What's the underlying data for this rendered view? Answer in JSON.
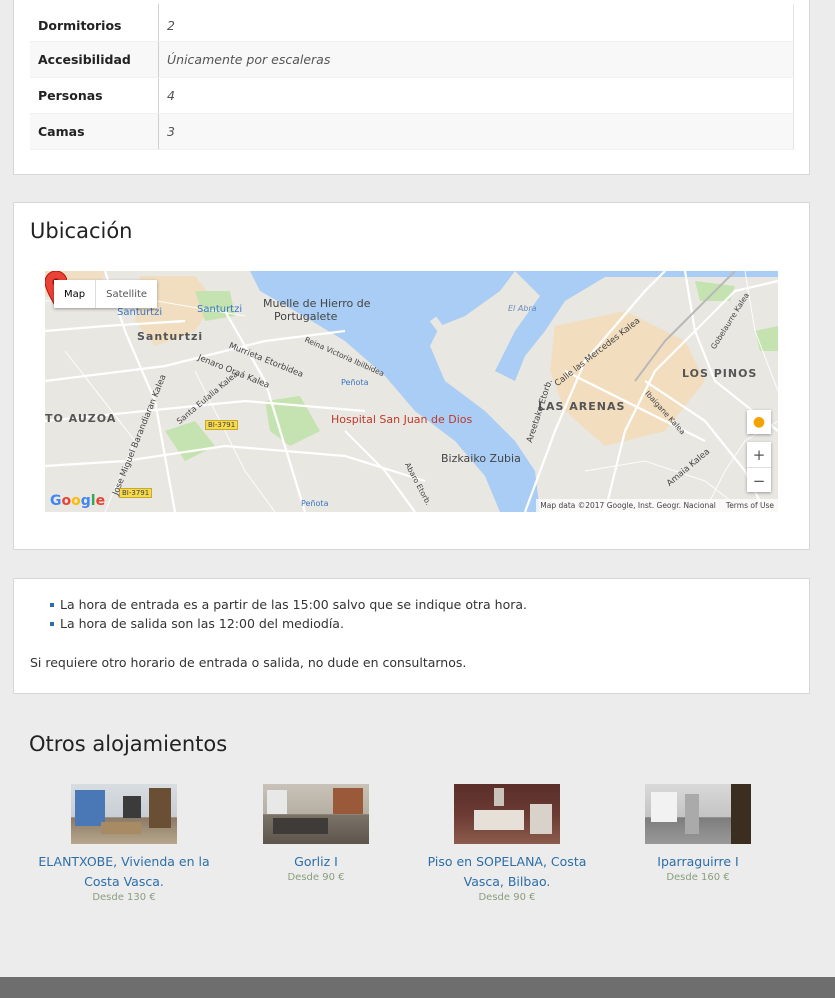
{
  "details": [
    {
      "label": "Dormitorios",
      "value": "2"
    },
    {
      "label": "Accesibilidad",
      "value": "Únicamente por escaleras"
    },
    {
      "label": "Personas",
      "value": "4"
    },
    {
      "label": "Camas",
      "value": "3"
    }
  ],
  "location": {
    "title": "Ubicación",
    "map_type_active": "Map",
    "map_type_inactive": "Satellite",
    "zoom_in": "+",
    "zoom_out": "−",
    "logo": "Google",
    "attribution": "Map data ©2017 Google, Inst. Geogr. Nacional",
    "terms": "Terms of Use",
    "labels": {
      "santurtzi_station": "Santurtzi",
      "santurtzi_station2": "Santurtzi",
      "santurtzi": "Santurtzi",
      "muelle1": "Muelle de Hierro de",
      "muelle2": "Portugalete",
      "el_abra": "El Abra",
      "los_pinos": "LOS PINOS",
      "las_arenas": "LAS ARENAS",
      "auzoa": "TO AUZOA",
      "hospital": "Hospital San Juan de Dios",
      "bizkaiko": "Bizkaiko Zubia",
      "penota": "Peñota",
      "penota2": "Peñota",
      "bi3791a": "BI-3791",
      "bi3791b": "BI-3791",
      "street1": "Murrieta Etorbidea",
      "street2": "Jenaro Oraá Kalea",
      "street3": "Calle las Mercedes Kalea",
      "street4": "Areetako Etorb.",
      "street5": "Amaia Kalea",
      "street6": "Reina Victoria Ibilbidea",
      "street7": "Jose Miguel Barandiaran Kalea",
      "street8": "Santa Eulalia Kalea",
      "street9": "Ibaigane Kalea",
      "street10": "Gobelaurre Kalea",
      "street11": "Abaro Etorb."
    }
  },
  "info": {
    "bullets": [
      "La hora de entrada es a partir de las 15:00 salvo que se indique otra hora.",
      "La hora de salida son las 12:00 del mediodía."
    ],
    "note": "Si requiere otro horario de entrada o salida, no dude en consultarnos."
  },
  "others": {
    "title": "Otros alojamientos",
    "items": [
      {
        "name": "ELANTXOBE, Vivienda en la Costa Vasca.",
        "price": "Desde 130 €"
      },
      {
        "name": "Gorliz I",
        "price": "Desde 90 €"
      },
      {
        "name": "Piso en SOPELANA, Costa Vasca, Bilbao.",
        "price": "Desde 90 €"
      },
      {
        "name": "Iparraguirre I",
        "price": "Desde 160 €"
      }
    ]
  }
}
